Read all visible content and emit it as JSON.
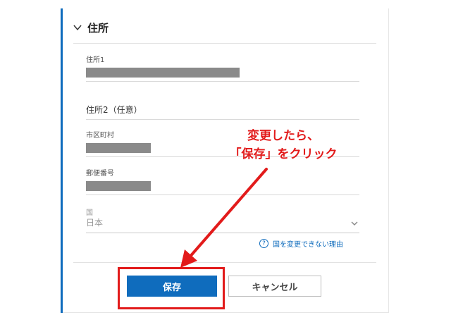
{
  "section": {
    "title": "住所"
  },
  "fields": {
    "address1": {
      "label": "住所1"
    },
    "address2": {
      "label": "住所2（任意）"
    },
    "city": {
      "label": "市区町村"
    },
    "postal": {
      "label": "郵便番号"
    },
    "country": {
      "label": "国",
      "value": "日本"
    }
  },
  "help": {
    "text": "国を変更できない理由",
    "icon": "?"
  },
  "buttons": {
    "save": "保存",
    "cancel": "キャンセル"
  },
  "annotation": {
    "line1": "変更したら、",
    "line2": "「保存」をクリック"
  },
  "colors": {
    "accent": "#0f6cbd",
    "annotation": "#e21b1b",
    "masked": "#8a8a8a"
  }
}
